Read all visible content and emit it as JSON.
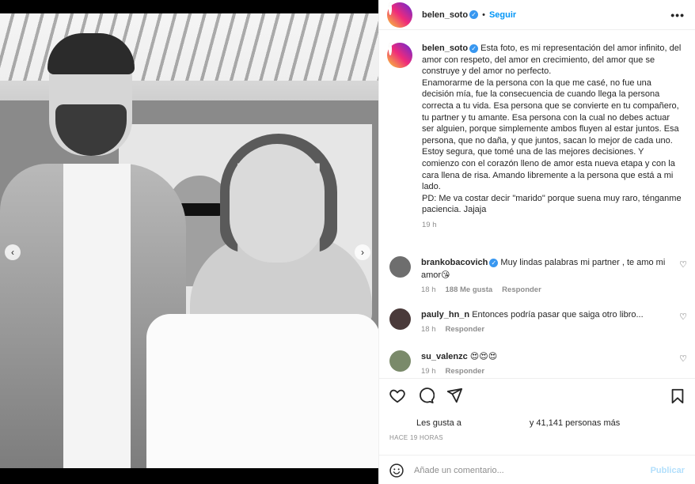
{
  "post": {
    "username": "belen_soto",
    "follow_label": "Seguir",
    "more_label": "•••"
  },
  "caption": {
    "username": "belen_soto",
    "paragraphs": [
      "Esta foto, es mi representación del amor infinito, del amor con respeto, del amor en crecimiento, del amor que se construye y del amor no perfecto.",
      "Enamorarme de la persona con la que me casé, no fue una decisión mía, fue la consecuencia de cuando llega la persona correcta a tu vida. Esa persona que se convierte en tu compañero, tu partner y tu amante. Esa persona con la cual no debes actuar ser alguien, porque simplemente ambos fluyen al estar juntos. Esa persona, que no daña, y que juntos, sacan lo mejor de cada uno.",
      "Estoy segura, que tomé una de las mejores decisiones. Y comienzo con el corazón lleno de amor esta nueva etapa y con la cara llena de risa. Amando libremente a la persona que está a mi lado.",
      "PD: Me va costar decir \"marido\" porque suena muy raro, ténganme paciencia. Jajaja"
    ],
    "time": "19 h"
  },
  "comments": [
    {
      "username": "brankobacovich",
      "verified": true,
      "text": "Muy lindas palabras mi partner , te amo mi amor😘",
      "time": "18 h",
      "likes": "188 Me gusta",
      "reply": "Responder"
    },
    {
      "username": "pauly_hn_n",
      "verified": false,
      "text": "Entonces podría pasar que saiga otro libro...",
      "time": "18 h",
      "likes": "",
      "reply": "Responder"
    },
    {
      "username": "su_valenzc",
      "verified": false,
      "text": "😍😍😍",
      "time": "19 h",
      "likes": "",
      "reply": "Responder"
    }
  ],
  "likes": {
    "prefix": "Les gusta a",
    "suffix": "y 41,141 personas más"
  },
  "time_ago": "HACE 19 HORAS",
  "comment_box": {
    "placeholder": "Añade un comentario...",
    "publish_label": "Publicar"
  },
  "carousel": {
    "total": 3,
    "active": 2
  }
}
